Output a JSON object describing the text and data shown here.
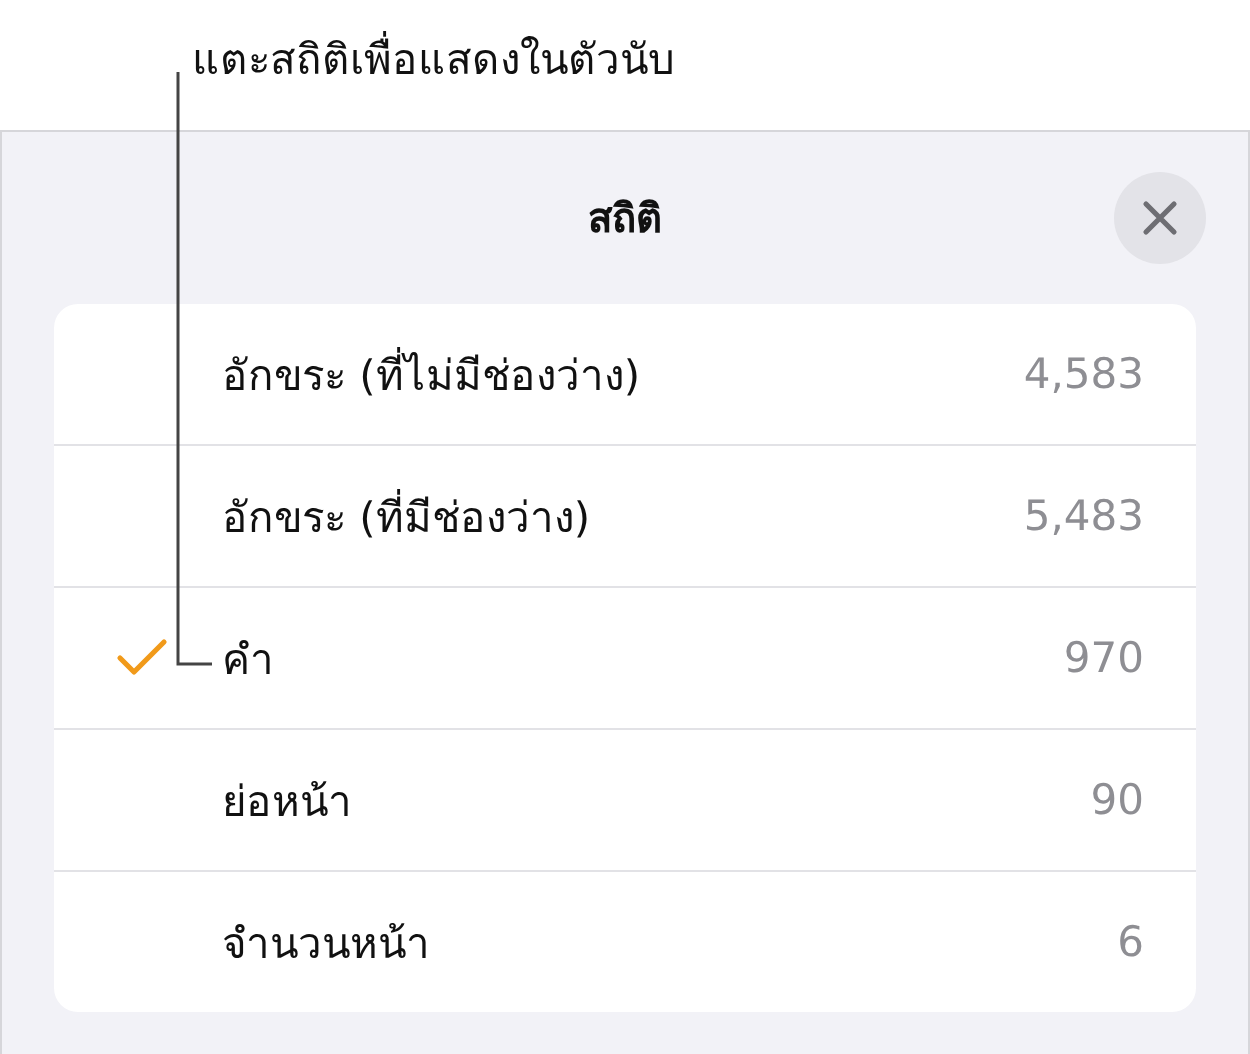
{
  "callout": "แตะสถิติเพื่อแสดงในตัวนับ",
  "title": "สถิติ",
  "rows": [
    {
      "label": "อักขระ (ที่ไม่มีช่องว่าง)",
      "value": "4,583",
      "selected": false
    },
    {
      "label": "อักขระ (ที่มีช่องว่าง)",
      "value": "5,483",
      "selected": false
    },
    {
      "label": "คำ",
      "value": "970",
      "selected": true
    },
    {
      "label": "ย่อหน้า",
      "value": "90",
      "selected": false
    },
    {
      "label": "จำนวนหน้า",
      "value": "6",
      "selected": false
    }
  ]
}
